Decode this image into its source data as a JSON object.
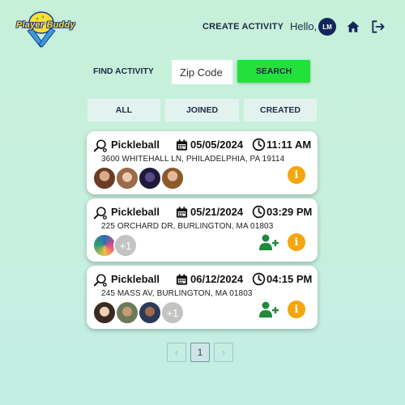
{
  "header": {
    "logo_text": "Player Buddy",
    "create_activity": "CREATE ACTIVITY",
    "hello": "Hello,",
    "avatar_initials": "LM"
  },
  "search": {
    "label": "FIND ACTIVITY",
    "zip_placeholder": "Zip Code",
    "zip_value": "",
    "button": "SEARCH"
  },
  "tabs": [
    {
      "label": "ALL"
    },
    {
      "label": "JOINED"
    },
    {
      "label": "CREATED"
    }
  ],
  "activities": [
    {
      "sport": "Pickleball",
      "date": "05/05/2024",
      "time": "11:11 AM",
      "address": "3600 WHITEHALL LN, PHILADELPHIA, PA 19114",
      "more": "",
      "can_join": false
    },
    {
      "sport": "Pickleball",
      "date": "05/21/2024",
      "time": "03:29 PM",
      "address": "225 ORCHARD DR, BURLINGTON, MA 01803",
      "more": "+1",
      "can_join": true
    },
    {
      "sport": "Pickleball",
      "date": "06/12/2024",
      "time": "04:15 PM",
      "address": "245 MASS AV, BURLINGTON, MA 01803",
      "more": "+1",
      "can_join": true
    }
  ],
  "pagination": {
    "prev": "‹",
    "current": "1",
    "next": "›"
  },
  "colors": {
    "accent_green": "#22e13a",
    "navy": "#13265c",
    "info_orange": "#f5a50d",
    "add_green": "#1f8a3a"
  }
}
